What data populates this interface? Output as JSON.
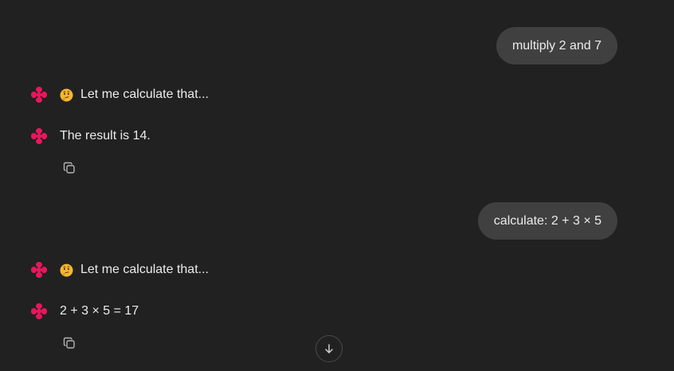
{
  "messages": {
    "user_1": "multiply 2 and 7",
    "bot_1": "Let me calculate that...",
    "bot_2": "The result is 14.",
    "user_2": "calculate: 2 + 3 × 5",
    "bot_3": "Let me calculate that...",
    "bot_4": "2 + 3 × 5 = 17"
  },
  "icons": {
    "bot_avatar": "diamond-dots-logo-icon",
    "thinking": "thinking-face-emoji-icon",
    "copy": "copy-icon",
    "scroll_down": "arrow-down-icon"
  },
  "colors": {
    "background": "#212121",
    "user_bubble": "#404040",
    "text": "#ececec",
    "brand": "#e8175d",
    "icon_muted": "#b4b4b4"
  }
}
